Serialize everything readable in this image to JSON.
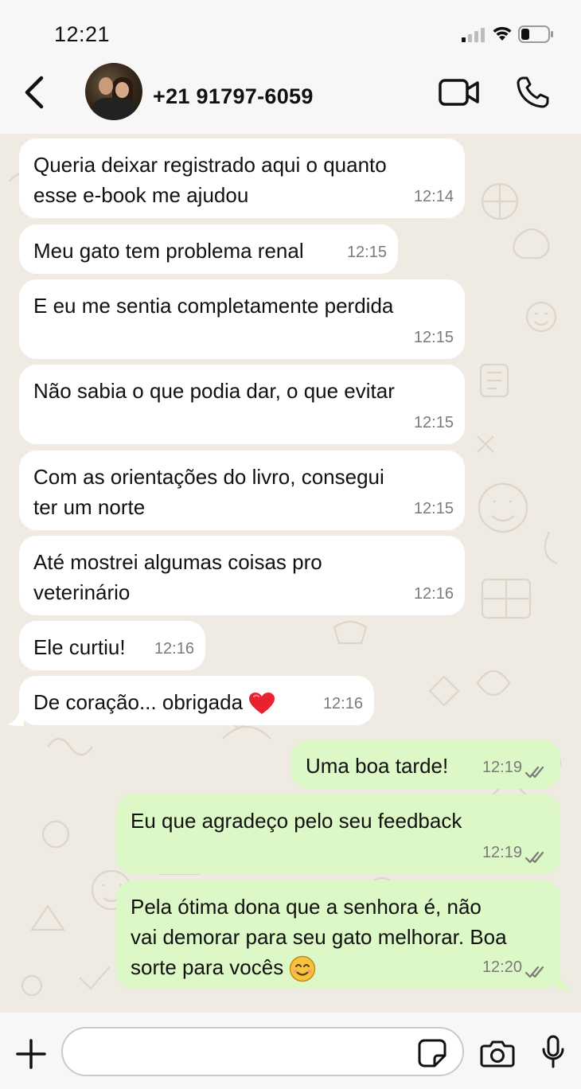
{
  "status_bar": {
    "time": "12:21"
  },
  "header": {
    "contact_name": "+21 91797-6059"
  },
  "messages": [
    {
      "direction": "in",
      "text": "Queria deixar registrado aqui o quanto\nesse e-book me ajudou",
      "time": "12:14"
    },
    {
      "direction": "in",
      "text": "Meu gato tem problema renal",
      "time": "12:15"
    },
    {
      "direction": "in",
      "text": "E eu me sentia completamente perdida",
      "time": "12:15"
    },
    {
      "direction": "in",
      "text": "Não sabia o que podia dar, o que evitar",
      "time": "12:15"
    },
    {
      "direction": "in",
      "text": "Com as orientações do livro, consegui\nter um norte",
      "time": "12:15"
    },
    {
      "direction": "in",
      "text": "Até mostrei algumas coisas pro\nveterinário",
      "time": "12:16"
    },
    {
      "direction": "in",
      "text": "Ele curtiu!",
      "time": "12:16"
    },
    {
      "direction": "in",
      "text": "De coração... obrigada",
      "emoji": "red-heart",
      "time": "12:16"
    },
    {
      "direction": "out",
      "text": "Uma boa tarde!",
      "time": "12:19",
      "status": "read"
    },
    {
      "direction": "out",
      "text": "Eu que agradeço pelo seu feedback",
      "time": "12:19",
      "status": "read"
    },
    {
      "direction": "out",
      "text": "Pela ótima dona que a senhora é, não\nvai demorar para seu gato melhorar. Boa\nsorte para vocês",
      "emoji": "smiling-face",
      "time": "12:20",
      "status": "read"
    }
  ],
  "input": {
    "placeholder": "",
    "value": ""
  },
  "colors": {
    "incoming_bubble": "#ffffff",
    "outgoing_bubble": "#dcf8c6",
    "chat_background": "#efeae2",
    "bar_background": "#f7f7f7",
    "heart": "#e8232f",
    "smiley": "#f7c23c"
  }
}
